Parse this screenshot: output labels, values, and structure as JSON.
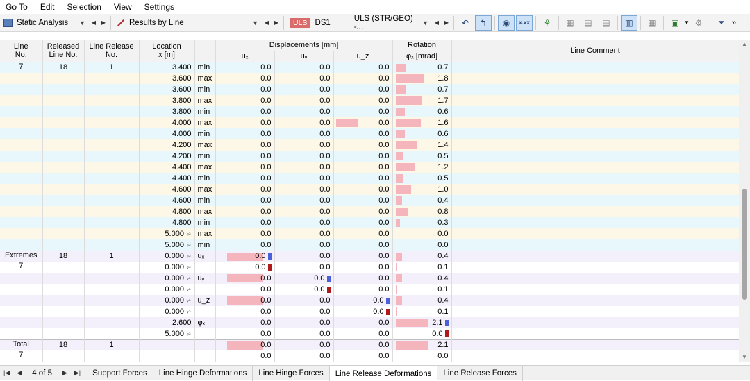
{
  "menu": [
    "Go To",
    "Edit",
    "Selection",
    "View",
    "Settings"
  ],
  "toolbar": {
    "analysis": "Static Analysis",
    "results": "Results by Line",
    "uls": "ULS",
    "ds": "DS1",
    "combo": "ULS (STR/GEO) -..."
  },
  "headers": {
    "line_no": [
      "Line",
      "No."
    ],
    "released": [
      "Released",
      "Line No."
    ],
    "release_no": [
      "Line Release",
      "No."
    ],
    "location": [
      "Location",
      "x [m]"
    ],
    "displacements": "Displacements [mm]",
    "ux": "uₓ",
    "uy": "uᵧ",
    "uz": "u_z",
    "rotation": "Rotation",
    "phix": "φₓ [mrad]",
    "comment": "Line Comment"
  },
  "rows": [
    {
      "line": "7",
      "rel": "18",
      "relno": "1",
      "x": "3.400",
      "t": "min",
      "ux": "0.0",
      "uy": "0.0",
      "uz": "0.0",
      "phi": "0.7",
      "phibar": 0.7,
      "uzbar": 0
    },
    {
      "line": "",
      "rel": "",
      "relno": "",
      "x": "3.600",
      "t": "max",
      "ux": "0.0",
      "uy": "0.0",
      "uz": "0.0",
      "phi": "1.8",
      "phibar": 1.8,
      "uzbar": 0
    },
    {
      "line": "",
      "rel": "",
      "relno": "",
      "x": "3.600",
      "t": "min",
      "ux": "0.0",
      "uy": "0.0",
      "uz": "0.0",
      "phi": "0.7",
      "phibar": 0.7,
      "uzbar": 0
    },
    {
      "line": "",
      "rel": "",
      "relno": "",
      "x": "3.800",
      "t": "max",
      "ux": "0.0",
      "uy": "0.0",
      "uz": "0.0",
      "phi": "1.7",
      "phibar": 1.7,
      "uzbar": 0
    },
    {
      "line": "",
      "rel": "",
      "relno": "",
      "x": "3.800",
      "t": "min",
      "ux": "0.0",
      "uy": "0.0",
      "uz": "0.0",
      "phi": "0.6",
      "phibar": 0.6,
      "uzbar": 0
    },
    {
      "line": "",
      "rel": "",
      "relno": "",
      "x": "4.000",
      "t": "max",
      "ux": "0.0",
      "uy": "0.0",
      "uz": "0.0",
      "phi": "1.6",
      "phibar": 1.6,
      "uzbar": 1
    },
    {
      "line": "",
      "rel": "",
      "relno": "",
      "x": "4.000",
      "t": "min",
      "ux": "0.0",
      "uy": "0.0",
      "uz": "0.0",
      "phi": "0.6",
      "phibar": 0.6,
      "uzbar": 0
    },
    {
      "line": "",
      "rel": "",
      "relno": "",
      "x": "4.200",
      "t": "max",
      "ux": "0.0",
      "uy": "0.0",
      "uz": "0.0",
      "phi": "1.4",
      "phibar": 1.4,
      "uzbar": 0
    },
    {
      "line": "",
      "rel": "",
      "relno": "",
      "x": "4.200",
      "t": "min",
      "ux": "0.0",
      "uy": "0.0",
      "uz": "0.0",
      "phi": "0.5",
      "phibar": 0.5,
      "uzbar": 0
    },
    {
      "line": "",
      "rel": "",
      "relno": "",
      "x": "4.400",
      "t": "max",
      "ux": "0.0",
      "uy": "0.0",
      "uz": "0.0",
      "phi": "1.2",
      "phibar": 1.2,
      "uzbar": 0
    },
    {
      "line": "",
      "rel": "",
      "relno": "",
      "x": "4.400",
      "t": "min",
      "ux": "0.0",
      "uy": "0.0",
      "uz": "0.0",
      "phi": "0.5",
      "phibar": 0.5,
      "uzbar": 0
    },
    {
      "line": "",
      "rel": "",
      "relno": "",
      "x": "4.600",
      "t": "max",
      "ux": "0.0",
      "uy": "0.0",
      "uz": "0.0",
      "phi": "1.0",
      "phibar": 1.0,
      "uzbar": 0
    },
    {
      "line": "",
      "rel": "",
      "relno": "",
      "x": "4.600",
      "t": "min",
      "ux": "0.0",
      "uy": "0.0",
      "uz": "0.0",
      "phi": "0.4",
      "phibar": 0.4,
      "uzbar": 0
    },
    {
      "line": "",
      "rel": "",
      "relno": "",
      "x": "4.800",
      "t": "max",
      "ux": "0.0",
      "uy": "0.0",
      "uz": "0.0",
      "phi": "0.8",
      "phibar": 0.8,
      "uzbar": 0
    },
    {
      "line": "",
      "rel": "",
      "relno": "",
      "x": "4.800",
      "t": "min",
      "ux": "0.0",
      "uy": "0.0",
      "uz": "0.0",
      "phi": "0.3",
      "phibar": 0.3,
      "uzbar": 0
    },
    {
      "line": "",
      "rel": "",
      "relno": "",
      "x": "5.000",
      "t": "max",
      "ux": "0.0",
      "uy": "0.0",
      "uz": "0.0",
      "phi": "0.0",
      "phibar": 0,
      "uzbar": 0,
      "sym": true
    },
    {
      "line": "",
      "rel": "",
      "relno": "",
      "x": "5.000",
      "t": "min",
      "ux": "0.0",
      "uy": "0.0",
      "uz": "0.0",
      "phi": "0.0",
      "phibar": 0,
      "uzbar": 0,
      "sym": true
    }
  ],
  "extremes_label": [
    "Extremes",
    "7"
  ],
  "extremes": [
    {
      "rel": "18",
      "relno": "1",
      "x": "0.000",
      "t": "uₓ",
      "ux": "0.0",
      "uy": "0.0",
      "uz": "0.0",
      "phi": "0.4",
      "uxbar": 1,
      "uybar": 0,
      "uzbar": 0,
      "phibar": 0.4,
      "mark": "ux-max"
    },
    {
      "rel": "",
      "relno": "",
      "x": "0.000",
      "t": "",
      "ux": "0.0",
      "uy": "0.0",
      "uz": "0.0",
      "phi": "0.1",
      "uxbar": 0,
      "uybar": 0,
      "uzbar": 0,
      "phibar": 0.1,
      "mark": "ux-min"
    },
    {
      "rel": "",
      "relno": "",
      "x": "0.000",
      "t": "uᵧ",
      "ux": "0.0",
      "uy": "0.0",
      "uz": "0.0",
      "phi": "0.4",
      "uxbar": 1,
      "uybar": 0,
      "uzbar": 0,
      "phibar": 0.4,
      "mark": "uy-max"
    },
    {
      "rel": "",
      "relno": "",
      "x": "0.000",
      "t": "",
      "ux": "0.0",
      "uy": "0.0",
      "uz": "0.0",
      "phi": "0.1",
      "uxbar": 0,
      "uybar": 0,
      "uzbar": 0,
      "phibar": 0.1,
      "mark": "uy-min"
    },
    {
      "rel": "",
      "relno": "",
      "x": "0.000",
      "t": "u_z",
      "ux": "0.0",
      "uy": "0.0",
      "uz": "0.0",
      "phi": "0.4",
      "uxbar": 1,
      "uybar": 0,
      "uzbar": 0,
      "phibar": 0.4,
      "mark": "uz-max"
    },
    {
      "rel": "",
      "relno": "",
      "x": "0.000",
      "t": "",
      "ux": "0.0",
      "uy": "0.0",
      "uz": "0.0",
      "phi": "0.1",
      "uxbar": 0,
      "uybar": 0,
      "uzbar": 0,
      "phibar": 0.1,
      "mark": "uz-min"
    },
    {
      "rel": "",
      "relno": "",
      "x": "2.600",
      "t": "φₓ",
      "ux": "0.0",
      "uy": "0.0",
      "uz": "0.0",
      "phi": "2.1",
      "uxbar": 0,
      "uybar": 0,
      "uzbar": 0,
      "phibar": 2.1,
      "mark": "phi-max",
      "nosym": true
    },
    {
      "rel": "",
      "relno": "",
      "x": "5.000",
      "t": "",
      "ux": "0.0",
      "uy": "0.0",
      "uz": "0.0",
      "phi": "0.0",
      "uxbar": 0,
      "uybar": 0,
      "uzbar": 0,
      "phibar": 0,
      "mark": "phi-min"
    }
  ],
  "total_label": [
    "Total",
    "7"
  ],
  "total": [
    {
      "rel": "18",
      "relno": "1",
      "ux": "0.0",
      "uy": "0.0",
      "uz": "0.0",
      "phi": "2.1",
      "uxbar": 1,
      "phibar": 2.1
    },
    {
      "rel": "",
      "relno": "",
      "ux": "0.0",
      "uy": "0.0",
      "uz": "0.0",
      "phi": "0.0",
      "uxbar": 0,
      "phibar": 0
    }
  ],
  "pager": "4 of 5",
  "tabs": [
    "Support Forces",
    "Line Hinge Deformations",
    "Line Hinge Forces",
    "Line Release Deformations",
    "Line Release Forces"
  ],
  "active_tab": "Line Release Deformations",
  "colors": {
    "bar": "#f4b6bc",
    "max_mark": "#4a5fd8",
    "min_mark": "#b01a1a"
  }
}
